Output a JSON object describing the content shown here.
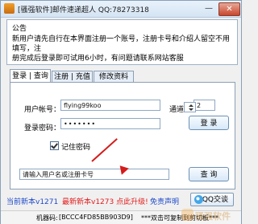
{
  "window": {
    "title": "[骚强软件]邮件速递超人 QQ:78273318",
    "minimize_glyph": "—",
    "close_glyph": "✕"
  },
  "announcement": {
    "heading": "公告",
    "line1": "新用户请先自行在本界面注册一个账号，注册卡号和介绍人留空不用填写，注",
    "line2": "册完成后登录即可试用6小时，有问题请联系网站客服"
  },
  "tabs": [
    {
      "label": "登录 | 查询"
    },
    {
      "label": "注册 | 充值"
    },
    {
      "label": "修改资料"
    }
  ],
  "login": {
    "username_label": "用户帐号：",
    "username_value": "flying99koo",
    "password_label": "登录密码：",
    "password_value": "•••••••",
    "channel_label": "通道号",
    "channel_value": "2",
    "login_button": "登 录",
    "remember_label": "记住密码",
    "card_query_value": "请输入用户名或注册卡号",
    "query_button": "查 询"
  },
  "footer": {
    "current_version": "当前新本v1271",
    "latest_version": "最新新本v1273 点此升级!",
    "free_statement": "免责声明",
    "qq_button": "QQ交谈"
  },
  "statusbar": {
    "machine_code_label": "机器码:",
    "machine_code_value": "[BCCC4FD85BB903D9]",
    "hint": "***双击可复制到剪切板***"
  },
  "watermark": {
    "brand": "骚强软件"
  },
  "colors": {
    "link_blue": "#1d49c8",
    "upgrade_red": "#e31b1b",
    "arrow_red": "#d51b1b"
  }
}
